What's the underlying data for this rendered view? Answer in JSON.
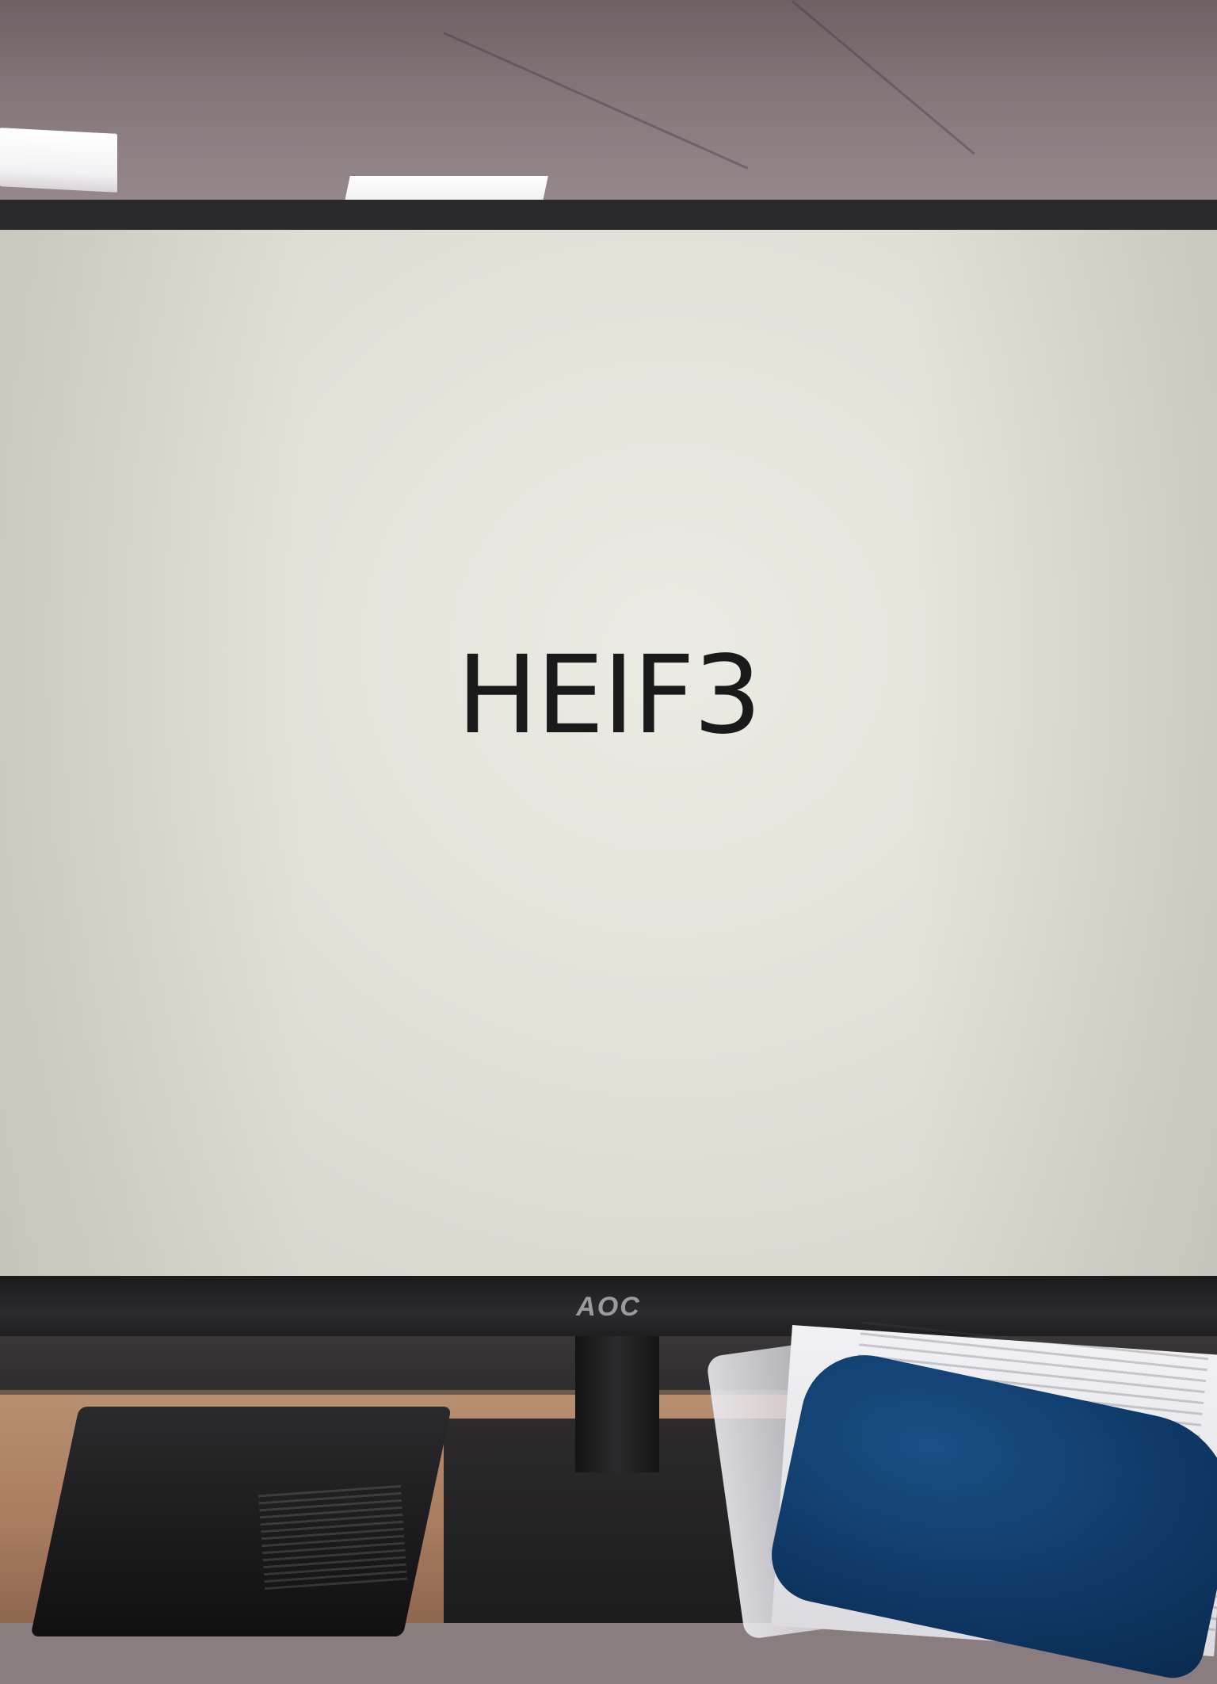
{
  "screen": {
    "text": "HEIF3",
    "background_color": "#e6e4dc",
    "text_color": "#1a1a1a"
  },
  "monitor": {
    "brand_logo": "AOC",
    "bezel_color": "#222224"
  },
  "scene": {
    "ceiling_color": "#8a7d80",
    "desk_color": "#b08468",
    "cushion_color": "#124272"
  }
}
